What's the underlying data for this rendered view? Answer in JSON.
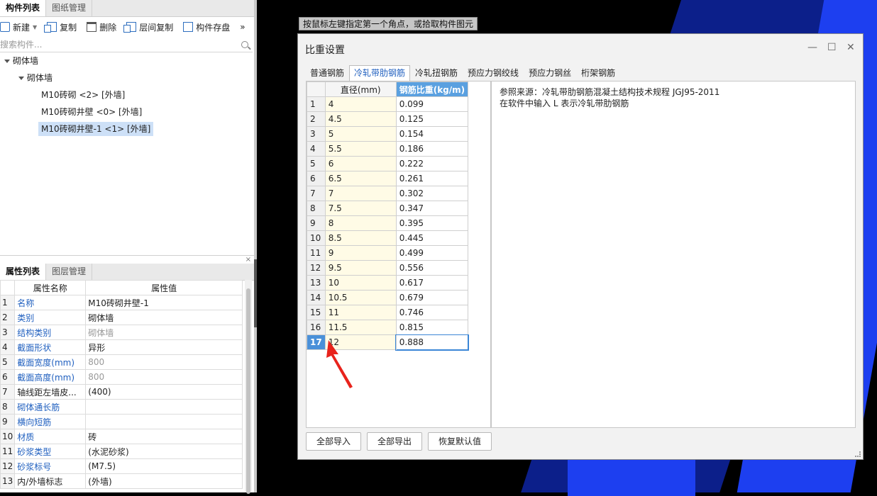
{
  "left_panel": {
    "tabs": [
      "构件列表",
      "图纸管理"
    ],
    "toolbar": {
      "new_label": "新建",
      "copy_label": "复制",
      "delete_label": "删除",
      "floor_copy_label": "层间复制",
      "save_label": "构件存盘",
      "more": "»"
    },
    "search_placeholder": "搜索构件...",
    "tree": {
      "root": "砌体墙",
      "group": "砌体墙",
      "items": [
        "M10砖砌 <2> [外墙]",
        "M10砖砌井壁 <0> [外墙]",
        "M10砖砌井壁-1 <1> [外墙]"
      ]
    },
    "props_tabs": [
      "属性列表",
      "图层管理"
    ],
    "props_close": "×",
    "props_header": {
      "name": "属性名称",
      "value": "属性值"
    },
    "props": [
      {
        "n": "1",
        "name": "名称",
        "value": "M10砖砌井壁-1",
        "name_style": "link",
        "value_style": ""
      },
      {
        "n": "2",
        "name": "类别",
        "value": "砌体墙",
        "name_style": "link",
        "value_style": ""
      },
      {
        "n": "3",
        "name": "结构类别",
        "value": "砌体墙",
        "name_style": "link",
        "value_style": "gray"
      },
      {
        "n": "4",
        "name": "截面形状",
        "value": "异形",
        "name_style": "link",
        "value_style": ""
      },
      {
        "n": "5",
        "name": "截面宽度(mm)",
        "value": "800",
        "name_style": "link",
        "value_style": "gray"
      },
      {
        "n": "6",
        "name": "截面高度(mm)",
        "value": "800",
        "name_style": "link",
        "value_style": "gray"
      },
      {
        "n": "7",
        "name": "轴线距左墙皮...",
        "value": "(400)",
        "name_style": "plain",
        "value_style": ""
      },
      {
        "n": "8",
        "name": "砌体通长筋",
        "value": "",
        "name_style": "link",
        "value_style": ""
      },
      {
        "n": "9",
        "name": "横向短筋",
        "value": "",
        "name_style": "link",
        "value_style": ""
      },
      {
        "n": "10",
        "name": "材质",
        "value": "砖",
        "name_style": "link",
        "value_style": ""
      },
      {
        "n": "11",
        "name": "砂浆类型",
        "value": "(水泥砂浆)",
        "name_style": "link",
        "value_style": ""
      },
      {
        "n": "12",
        "name": "砂浆标号",
        "value": "(M7.5)",
        "name_style": "link",
        "value_style": ""
      },
      {
        "n": "13",
        "name": "内/外墙标志",
        "value": "(外墙)",
        "name_style": "plain",
        "value_style": ""
      }
    ]
  },
  "hint": "按鼠标左键指定第一个角点，或拾取构件图元",
  "dialog": {
    "title": "比重设置",
    "win_min": "—",
    "win_max": "☐",
    "win_close": "✕",
    "tabs": [
      "普通钢筋",
      "冷轧带肋钢筋",
      "冷轧扭钢筋",
      "预应力钢绞线",
      "预应力钢丝",
      "桁架钢筋"
    ],
    "active_tab": 1,
    "table_header": {
      "diameter": "直径(mm)",
      "ratio": "钢筋比重(kg/m)"
    },
    "rows": [
      {
        "n": "1",
        "d": "4",
        "r": "0.099"
      },
      {
        "n": "2",
        "d": "4.5",
        "r": "0.125"
      },
      {
        "n": "3",
        "d": "5",
        "r": "0.154"
      },
      {
        "n": "4",
        "d": "5.5",
        "r": "0.186"
      },
      {
        "n": "5",
        "d": "6",
        "r": "0.222"
      },
      {
        "n": "6",
        "d": "6.5",
        "r": "0.261"
      },
      {
        "n": "7",
        "d": "7",
        "r": "0.302"
      },
      {
        "n": "8",
        "d": "7.5",
        "r": "0.347"
      },
      {
        "n": "9",
        "d": "8",
        "r": "0.395"
      },
      {
        "n": "10",
        "d": "8.5",
        "r": "0.445"
      },
      {
        "n": "11",
        "d": "9",
        "r": "0.499"
      },
      {
        "n": "12",
        "d": "9.5",
        "r": "0.556"
      },
      {
        "n": "13",
        "d": "10",
        "r": "0.617"
      },
      {
        "n": "14",
        "d": "10.5",
        "r": "0.679"
      },
      {
        "n": "15",
        "d": "11",
        "r": "0.746"
      },
      {
        "n": "16",
        "d": "11.5",
        "r": "0.815"
      },
      {
        "n": "17",
        "d": "12",
        "r": "0.888"
      }
    ],
    "selected_row": 17,
    "reference_line1": "参照来源：冷轧带肋钢筋混凝土结构技术规程 JGJ95-2011",
    "reference_line2": "在软件中输入 L 表示冷轧带肋钢筋",
    "buttons": {
      "import_all": "全部导入",
      "export_all": "全部导出",
      "restore_default": "恢复默认值"
    }
  },
  "colors": {
    "accent": "#1f5fbf",
    "selected_row": "#4a90d9",
    "diameter_col_bg": "#fffbe6",
    "arrow": "#e8231c"
  }
}
